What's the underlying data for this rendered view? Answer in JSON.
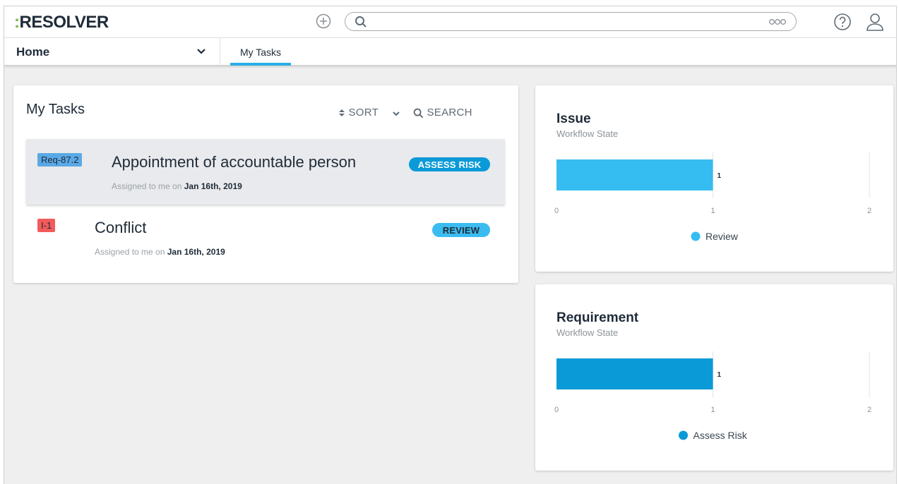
{
  "app": {
    "logo_prefix": ":",
    "logo_text": "RESOLVER",
    "search_placeholder": ""
  },
  "nav": {
    "home_label": "Home",
    "tabs": [
      {
        "label": "My Tasks",
        "active": true
      }
    ]
  },
  "tasks_panel": {
    "title": "My Tasks",
    "sort_label": "SORT",
    "search_label": "SEARCH",
    "tasks": [
      {
        "id": "Req-87.2",
        "title": "Appointment of accountable person",
        "assigned_prefix": "Assigned to me on",
        "assigned_date": "Jan 16th, 2019",
        "state": "ASSESS RISK",
        "badge_color": "#5aa9e6",
        "state_bg": "#0a9ad8",
        "state_fg": "#ffffff"
      },
      {
        "id": "I-1",
        "title": "Conflict",
        "assigned_prefix": "Assigned to me on",
        "assigned_date": "Jan 16th, 2019",
        "state": "REVIEW",
        "badge_color": "#f25b5b",
        "state_bg": "#3bbcf0",
        "state_fg": "#1f2b38"
      }
    ]
  },
  "chart_data": [
    {
      "type": "bar",
      "orientation": "horizontal",
      "title": "Issue",
      "subtitle": "Workflow State",
      "categories": [
        "Review"
      ],
      "series": [
        {
          "name": "Review",
          "values": [
            1
          ],
          "color": "#35bcf0"
        }
      ],
      "xlim": [
        0,
        2
      ],
      "xticks": [
        "0",
        "1",
        "2"
      ],
      "data_labels": [
        "1"
      ],
      "legend_position": "bottom"
    },
    {
      "type": "bar",
      "orientation": "horizontal",
      "title": "Requirement",
      "subtitle": "Workflow State",
      "categories": [
        "Assess Risk"
      ],
      "series": [
        {
          "name": "Assess Risk",
          "values": [
            1
          ],
          "color": "#0a9ad8"
        }
      ],
      "xlim": [
        0,
        2
      ],
      "xticks": [
        "0",
        "1",
        "2"
      ],
      "data_labels": [
        "1"
      ],
      "legend_position": "bottom"
    }
  ]
}
